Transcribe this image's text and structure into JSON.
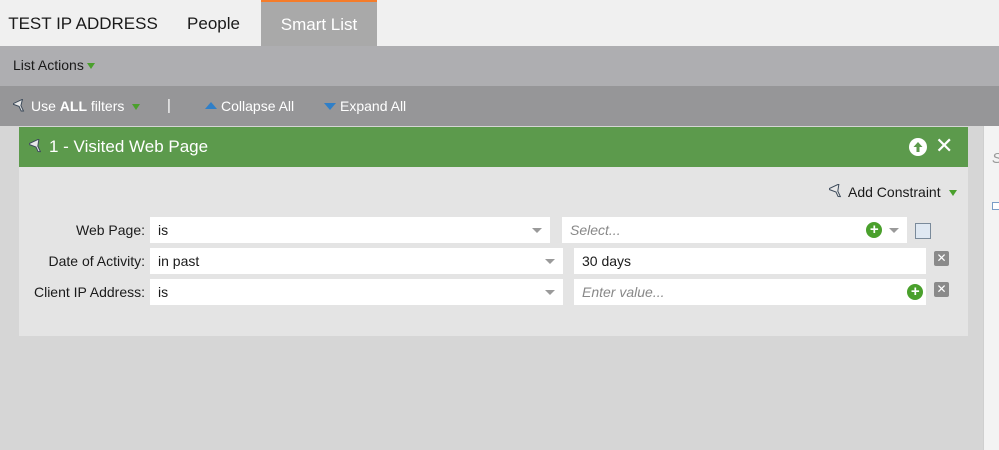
{
  "tabs": [
    {
      "label": "TEST IP ADDRESS"
    },
    {
      "label": "People"
    },
    {
      "label": "Smart List"
    }
  ],
  "actions": {
    "list_actions": "List Actions"
  },
  "filterbar": {
    "use_prefix": "Use ",
    "use_bold": "ALL",
    "use_suffix": " filters",
    "separator": "|",
    "collapse_all": "Collapse All",
    "expand_all": "Expand All"
  },
  "filter": {
    "title": "1 - Visited Web Page",
    "add_constraint": "Add Constraint",
    "rows": [
      {
        "label": "Web Page:",
        "operator": "is",
        "value_placeholder": "Select..."
      },
      {
        "label": "Date of Activity:",
        "operator": "in past",
        "value": "30 days"
      },
      {
        "label": "Client IP Address:",
        "operator": "is",
        "value_placeholder": "Enter value..."
      }
    ]
  },
  "right_panel": {
    "initial": "S"
  },
  "colors": {
    "accent_orange": "#f57c2a",
    "header_green": "#5c9a4c",
    "icon_green": "#4aa02c",
    "icon_blue": "#2f7fc8"
  }
}
